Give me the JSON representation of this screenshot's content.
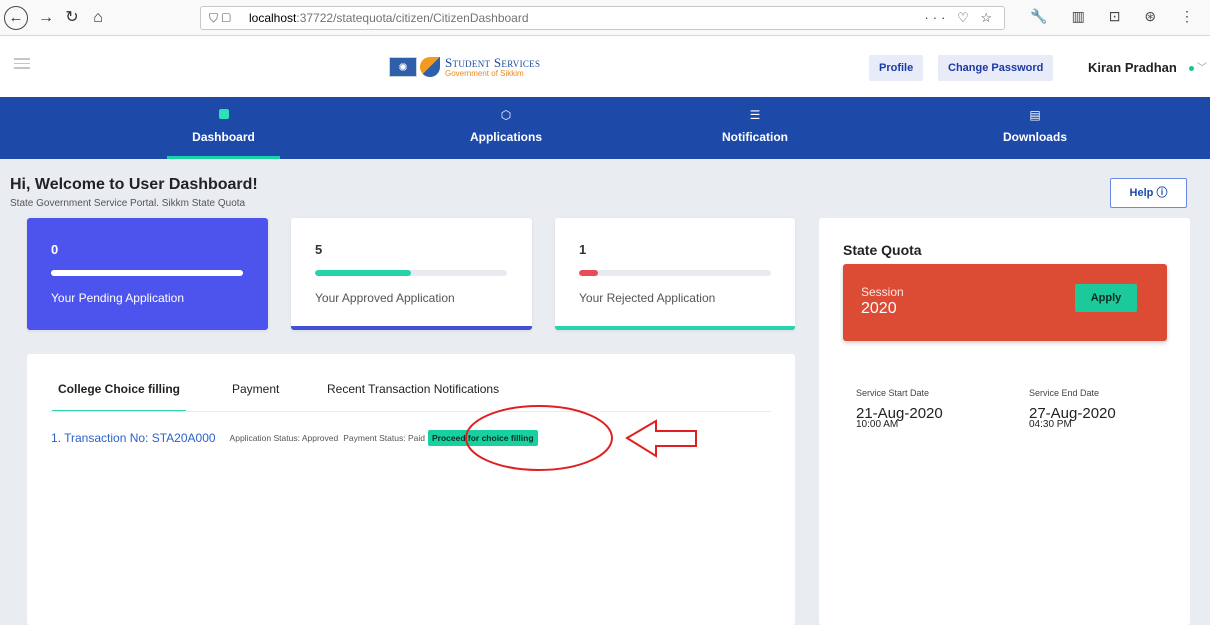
{
  "browser": {
    "url_host": "localhost",
    "url_path": ":37722/statequota/citizen/CitizenDashboard",
    "url_actions": "··· ♡ ☆",
    "tools": "🔧 ▥ ⊡ ⊛ ⋮"
  },
  "header": {
    "logo_title": "Student Services",
    "logo_subtitle": "Government of Sikkim",
    "profile_label": "Profile",
    "change_password_label": "Change Password",
    "user_name": "Kiran Pradhan"
  },
  "nav": {
    "items": [
      {
        "label": "Dashboard",
        "icon": "dashboard-icon"
      },
      {
        "label": "Applications",
        "icon": "cube-icon"
      },
      {
        "label": "Notification",
        "icon": "list-icon"
      },
      {
        "label": "Downloads",
        "icon": "document-icon"
      }
    ]
  },
  "welcome": {
    "title": "Hi, Welcome to User Dashboard!",
    "subtitle": "State Government Service Portal. Sikkm State Quota",
    "help_label": "Help"
  },
  "stats": {
    "pending": {
      "count": "0",
      "label": "Your Pending Application",
      "progress": 1.0
    },
    "approved": {
      "count": "5",
      "label": "Your Approved Application",
      "progress": 0.5
    },
    "rejected": {
      "count": "1",
      "label": "Your Rejected Application",
      "progress": 0.1
    }
  },
  "quota": {
    "title": "State Quota",
    "session_label": "Session",
    "session_year": "2020",
    "apply_label": "Apply",
    "start_label": "Service Start Date",
    "start_date": "21-Aug-2020",
    "start_time": "10:00 AM",
    "end_label": "Service End Date",
    "end_date": "27-Aug-2020",
    "end_time": "04:30 PM"
  },
  "tabs": {
    "items": [
      "College Choice filling",
      "Payment",
      "Recent Transaction Notifications"
    ]
  },
  "transaction": {
    "link": "1. Transaction No: STA20A000",
    "app_status": "Application Status: Approved",
    "pay_status": "Payment Status: Paid",
    "proceed_label": "Proceed for choice filling"
  },
  "colors": {
    "primary": "#1d49a8",
    "accent": "#18d2a6",
    "pending_card": "#4d54ee",
    "session_box": "#dc4c35",
    "annotation": "#e02020"
  }
}
